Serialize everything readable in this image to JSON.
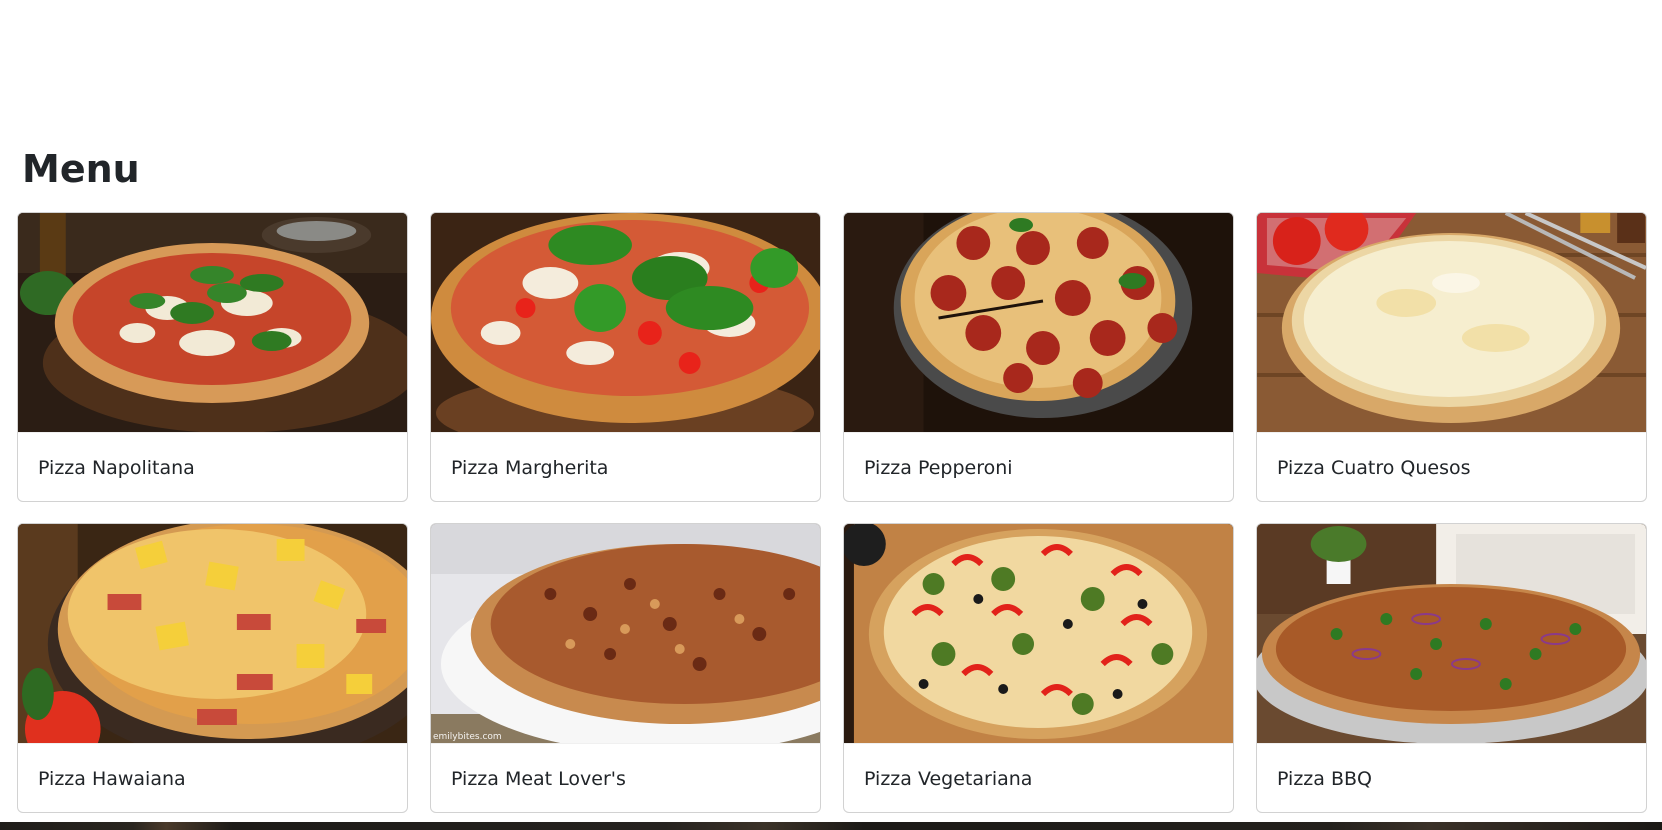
{
  "page": {
    "title": "Menu"
  },
  "menu": {
    "items": [
      {
        "name": "Pizza Napolitana",
        "image": "pizza-napolitana-photo"
      },
      {
        "name": "Pizza Margherita",
        "image": "pizza-margherita-photo"
      },
      {
        "name": "Pizza Pepperoni",
        "image": "pizza-pepperoni-photo"
      },
      {
        "name": "Pizza Cuatro Quesos",
        "image": "pizza-cuatro-quesos-photo"
      },
      {
        "name": "Pizza Hawaiana",
        "image": "pizza-hawaiana-photo"
      },
      {
        "name": "Pizza Meat Lover's",
        "image": "pizza-meat-lovers-photo",
        "watermark": "emilybites.com"
      },
      {
        "name": "Pizza Vegetariana",
        "image": "pizza-vegetariana-photo"
      },
      {
        "name": "Pizza BBQ",
        "image": "pizza-bbq-photo"
      }
    ]
  },
  "colors": {
    "text": "#212529",
    "card_border": "#d9d9d9",
    "background": "#ffffff"
  }
}
